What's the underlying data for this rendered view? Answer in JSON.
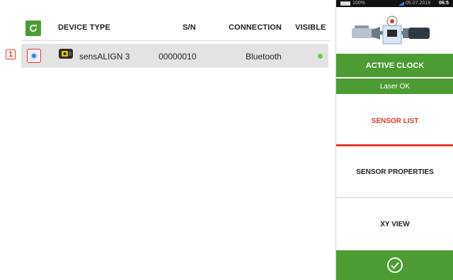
{
  "table": {
    "headers": {
      "device_type": "DEVICE TYPE",
      "sn": "S/N",
      "connection": "CONNECTION",
      "visible": "VISIBLE"
    },
    "rows": [
      {
        "index": "1",
        "device_type": "sensALIGN 3",
        "sn": "00000010",
        "connection": "Bluetooth",
        "visible": true
      }
    ]
  },
  "status_bar": {
    "battery": "100%",
    "date": "05.07.2019",
    "time": "06:5"
  },
  "panel": {
    "active_clock": "ACTIVE CLOCK",
    "laser_status": "Laser OK",
    "menu": [
      {
        "label": "SENSOR LIST",
        "active": true
      },
      {
        "label": "SENSOR PROPERTIES",
        "active": false
      },
      {
        "label": "XY VIEW",
        "active": false
      }
    ]
  },
  "colors": {
    "accent_green": "#4c9c33",
    "active_red": "#e23b2b",
    "visible_dot": "#7cc13f"
  },
  "icons": {
    "refresh": "refresh-icon",
    "device": "sensor-device-icon",
    "confirm": "checkmark-circle-icon"
  }
}
